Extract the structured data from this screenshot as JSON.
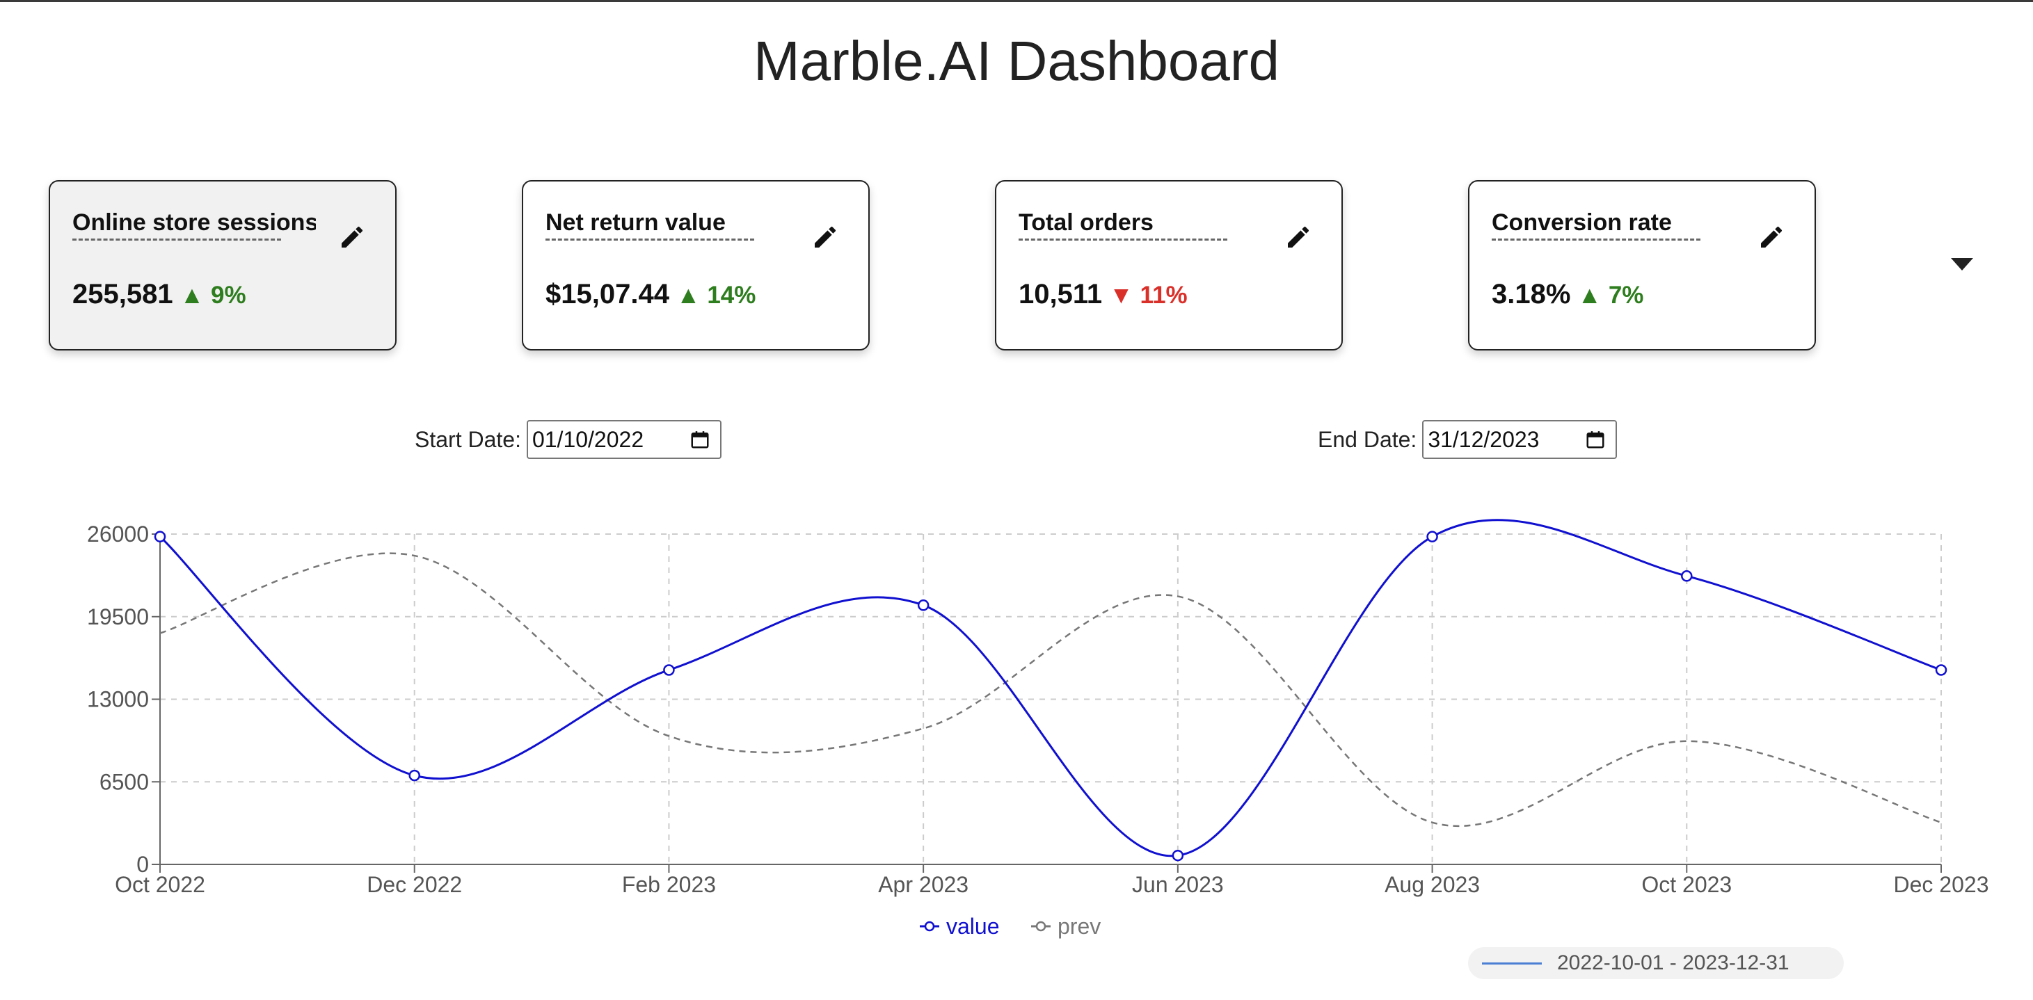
{
  "page": {
    "title": "Marble.AI Dashboard"
  },
  "cards": [
    {
      "title": "Online store sessions",
      "value": "255,581",
      "delta": "9%",
      "direction": "up",
      "selected": true
    },
    {
      "title": "Net return value",
      "value": "$15,07.44",
      "delta": "14%",
      "direction": "up",
      "selected": false
    },
    {
      "title": "Total orders",
      "value": "10,511",
      "delta": "11%",
      "direction": "down",
      "selected": false
    },
    {
      "title": "Conversion rate",
      "value": "3.18%",
      "delta": "7%",
      "direction": "up",
      "selected": false
    }
  ],
  "icons": {
    "edit": "pencil-icon",
    "expand": "caret-down-icon",
    "calendar": "calendar-icon",
    "up": "triangle-up-icon",
    "down": "triangle-down-icon"
  },
  "dates": {
    "start_label": "Start Date:",
    "start_value": "01/10/2022",
    "end_label": "End Date:",
    "end_value": "31/12/2023"
  },
  "range_chip": {
    "text": "2022-10-01 - 2023-12-31"
  },
  "colors": {
    "value_series": "#1010d0",
    "prev_series": "#777777",
    "up": "#2e7d1e",
    "down": "#d9302a",
    "range_line": "#4a7fd4"
  },
  "chart_data": {
    "type": "line",
    "x": [
      "Oct 2022",
      "Dec 2022",
      "Feb 2023",
      "Apr 2023",
      "Jun 2023",
      "Aug 2023",
      "Oct 2023",
      "Dec 2023"
    ],
    "series": [
      {
        "name": "value",
        "values": [
          25800,
          7000,
          15300,
          20400,
          700,
          25800,
          22700,
          15300
        ],
        "style": "solid",
        "color": "#1010d0",
        "markers": true
      },
      {
        "name": "prev",
        "values": [
          18200,
          24300,
          10100,
          10700,
          21100,
          3300,
          9700,
          3300
        ],
        "style": "dashed",
        "color": "#777777",
        "markers": false
      }
    ],
    "yticks": [
      0,
      6500,
      13000,
      19500,
      26000
    ],
    "ylim": [
      0,
      26000
    ],
    "grid": true,
    "legend": "bottom-center"
  }
}
